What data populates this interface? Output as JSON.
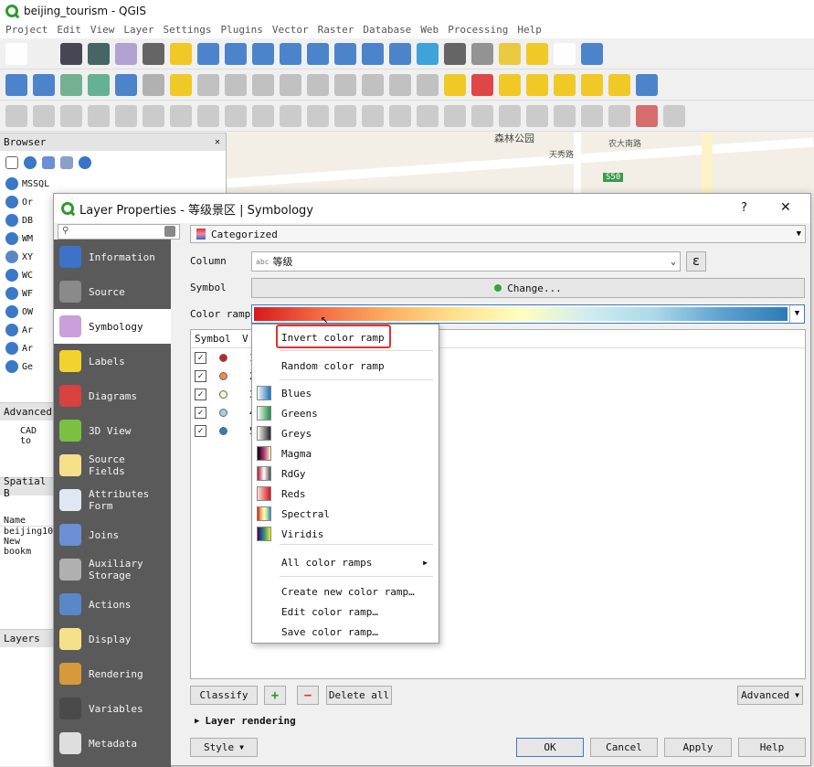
{
  "window": {
    "title": "beijing_tourism - QGIS"
  },
  "menubar": [
    "Project",
    "Edit",
    "View",
    "Layer",
    "Settings",
    "Plugins",
    "Vector",
    "Raster",
    "Database",
    "Web",
    "Processing",
    "Help"
  ],
  "browser": {
    "title": "Browser",
    "items": [
      "MSSQL",
      "Or",
      "DB",
      "WM",
      "XY",
      "WC",
      "WF",
      "OW",
      "Ar",
      "Ar",
      "Ge"
    ]
  },
  "advanced_panel": {
    "title": "Advanced",
    "text": "CAD to"
  },
  "spatial_panel": {
    "title": "Spatial B",
    "col_name": "Name",
    "rows": [
      "beijing10",
      "New bookm"
    ]
  },
  "layers_panel": {
    "title": "Layers"
  },
  "map": {
    "labels": [
      "森林公园",
      "天秀路",
      "农大南路",
      "S50"
    ]
  },
  "dialog": {
    "title": "Layer Properties - 等级景区 | Symbology",
    "help": "?",
    "close": "✕",
    "search_placeholder": "",
    "sidebar": [
      {
        "label": "Information",
        "icon": "info-icon",
        "color": "#3b73c8"
      },
      {
        "label": "Source",
        "icon": "source-wrench-icon",
        "color": "#8a8a8a"
      },
      {
        "label": "Symbology",
        "icon": "symbology-brush-icon",
        "color": "#c9a0dc"
      },
      {
        "label": "Labels",
        "icon": "labels-abc-icon",
        "color": "#f2d22e"
      },
      {
        "label": "Diagrams",
        "icon": "diagrams-icon",
        "color": "#d94040"
      },
      {
        "label": "3D View",
        "icon": "cube-3d-icon",
        "color": "#7bc043"
      },
      {
        "label": "Source Fields",
        "icon": "fields-icon",
        "color": "#f5e08a"
      },
      {
        "label": "Attributes Form",
        "icon": "form-icon",
        "color": "#dfe7f3"
      },
      {
        "label": "Joins",
        "icon": "joins-icon",
        "color": "#6a8fd4"
      },
      {
        "label": "Auxiliary Storage",
        "icon": "storage-icon",
        "color": "#b0b0b0"
      },
      {
        "label": "Actions",
        "icon": "actions-gear-icon",
        "color": "#5a87c7"
      },
      {
        "label": "Display",
        "icon": "display-bubble-icon",
        "color": "#f5e18a"
      },
      {
        "label": "Rendering",
        "icon": "rendering-brush-icon",
        "color": "#d69a3b"
      },
      {
        "label": "Variables",
        "icon": "variables-icon",
        "color": "#4a4a4a"
      },
      {
        "label": "Metadata",
        "icon": "metadata-icon",
        "color": "#dedede"
      }
    ],
    "renderer": "Categorized",
    "column_label": "Column",
    "column_value": "等级",
    "column_prefix": "abc",
    "symbol_label": "Symbol",
    "change_button": "Change...",
    "color_ramp_label": "Color ramp",
    "table_headers": [
      "Symbol",
      "V"
    ],
    "categories": [
      {
        "value": "1",
        "color": "#c0242a"
      },
      {
        "value": "2",
        "color": "#f08a4b"
      },
      {
        "value": "3",
        "color": "#f7f5c8"
      },
      {
        "value": "4",
        "color": "#a6cfe2"
      },
      {
        "value": "5",
        "color": "#2f7fb6"
      }
    ],
    "buttons": {
      "classify": "Classify",
      "delete_all": "Delete all",
      "advanced": "Advanced"
    },
    "layer_rendering": "Layer rendering",
    "bottom": {
      "style": "Style",
      "ok": "OK",
      "cancel": "Cancel",
      "apply": "Apply",
      "help": "Help"
    }
  },
  "popup": {
    "invert": "Invert color ramp",
    "random": "Random color ramp",
    "ramps": [
      {
        "label": "Blues",
        "swatch": [
          "#f7fbff",
          "#2171b5"
        ]
      },
      {
        "label": "Greens",
        "swatch": [
          "#f7fcf5",
          "#238b45"
        ]
      },
      {
        "label": "Greys",
        "swatch": [
          "#ffffff",
          "#252525"
        ]
      },
      {
        "label": "Magma",
        "swatch": [
          "#000004",
          "#b5367a",
          "#fcfdbf"
        ]
      },
      {
        "label": "RdGy",
        "swatch": [
          "#b2182b",
          "#ffffff",
          "#4d4d4d"
        ]
      },
      {
        "label": "Reds",
        "swatch": [
          "#fee0d2",
          "#cb181d"
        ]
      },
      {
        "label": "Spectral",
        "swatch": [
          "#d7191c",
          "#fdae61",
          "#ffffbf",
          "#abdda4",
          "#2b83ba"
        ]
      },
      {
        "label": "Viridis",
        "swatch": [
          "#440154",
          "#21918c",
          "#fde725"
        ]
      }
    ],
    "all": "All color ramps",
    "create": "Create new color ramp…",
    "edit": "Edit color ramp…",
    "save": "Save color ramp…"
  },
  "colors": {
    "ramp": [
      "#d7191c",
      "#f46d43",
      "#fdae61",
      "#fee08b",
      "#ffffbf",
      "#d1ecf0",
      "#abd9e9",
      "#5fa2d0",
      "#2c7bb6"
    ],
    "highlight": "#e53030",
    "sidebar": "#5a5a5a"
  }
}
